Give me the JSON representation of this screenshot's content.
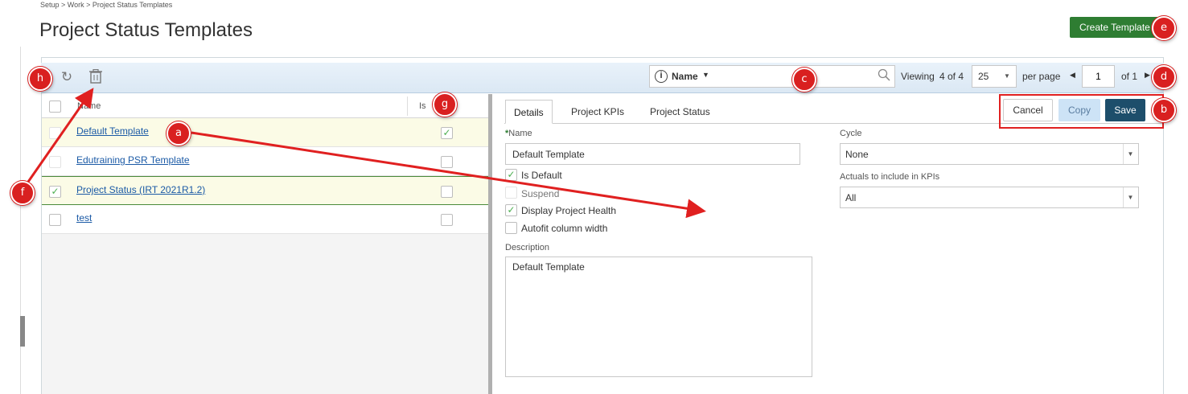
{
  "breadcrumb": "Setup > Work > Project Status Templates",
  "page_title": "Project Status Templates",
  "create_button_label": "Create Template",
  "toolbar": {
    "refresh_icon": "refresh-icon",
    "delete_icon": "trash-icon",
    "search": {
      "field_label": "Name",
      "value": "",
      "info_icon": "info-icon",
      "search_icon": "search-icon"
    },
    "viewing_prefix": "Viewing",
    "viewing_count": "4 of 4",
    "page_size": "25",
    "per_page_label": "per page",
    "page_number": "1",
    "of_label": "of 1"
  },
  "list": {
    "columns": [
      "Name",
      "Is"
    ],
    "rows": [
      {
        "name": "Default Template",
        "selected": false,
        "is_default": true
      },
      {
        "name": "Edutraining PSR Template",
        "selected": false,
        "is_default": false
      },
      {
        "name": "Project Status (IRT 2021R1.2)",
        "selected": true,
        "is_default": false
      },
      {
        "name": "test",
        "selected": false,
        "is_default": false
      }
    ]
  },
  "detail": {
    "tabs": [
      "Details",
      "Project KPIs",
      "Project Status"
    ],
    "active_tab": "Details",
    "buttons": {
      "cancel": "Cancel",
      "copy": "Copy",
      "save": "Save"
    },
    "name_label": "Name",
    "name_value": "Default Template",
    "checkboxes": [
      {
        "label": "Is Default",
        "checked": true
      },
      {
        "label": "Suspend",
        "checked": false
      },
      {
        "label": "Display Project Health",
        "checked": true
      },
      {
        "label": "Autofit column width",
        "checked": false
      }
    ],
    "description_label": "Description",
    "description_value": "Default Template",
    "cycle_label": "Cycle",
    "cycle_value": "None",
    "actuals_label": "Actuals to include in KPIs",
    "actuals_value": "All"
  },
  "annotations": [
    "a",
    "b",
    "c",
    "d",
    "e",
    "f",
    "g",
    "h"
  ],
  "colors": {
    "accent_green": "#2e7d32",
    "link_blue": "#1b5aa6",
    "save_navy": "#1d4e6b",
    "annotation_red": "#d92020"
  }
}
